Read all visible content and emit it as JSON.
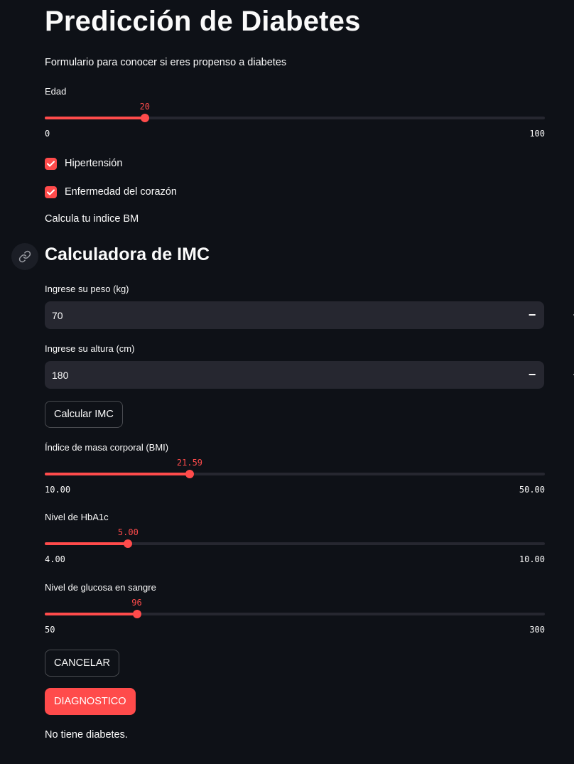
{
  "header": {
    "title": "Predicción de Diabetes",
    "subtitle": "Formulario para conocer si eres propenso a diabetes"
  },
  "edad": {
    "label": "Edad",
    "value": "20",
    "min": "0",
    "max": "100",
    "fraction": 0.2
  },
  "checkboxes": [
    {
      "label": "Hipertensión",
      "checked": true
    },
    {
      "label": "Enfermedad del corazón",
      "checked": true
    }
  ],
  "bmi_note": "Calcula tu indice BM",
  "calculator": {
    "title": "Calculadora de IMC",
    "link_icon": "link-icon",
    "peso": {
      "label": "Ingrese su peso (kg)",
      "value": "70"
    },
    "altura": {
      "label": "Ingrese su altura (cm)",
      "value": "180"
    },
    "minus": "−",
    "plus": "+",
    "button": "Calcular IMC"
  },
  "bmi": {
    "label": "Índice de masa corporal (BMI)",
    "value": "21.59",
    "min": "10.00",
    "max": "50.00",
    "fraction": 0.28975
  },
  "hba1c": {
    "label": "Nivel de HbA1c",
    "value": "5.00",
    "min": "4.00",
    "max": "10.00",
    "fraction": 0.1667
  },
  "glucosa": {
    "label": "Nivel de glucosa en sangre",
    "value": "96",
    "min": "50",
    "max": "300",
    "fraction": 0.184
  },
  "actions": {
    "cancel": "CANCELAR",
    "diagnose": "DIAGNOSTICO"
  },
  "result": "No tiene diabetes.",
  "colors": {
    "accent": "#ff4b4b",
    "background": "#0e1117",
    "input_bg": "#262730"
  }
}
